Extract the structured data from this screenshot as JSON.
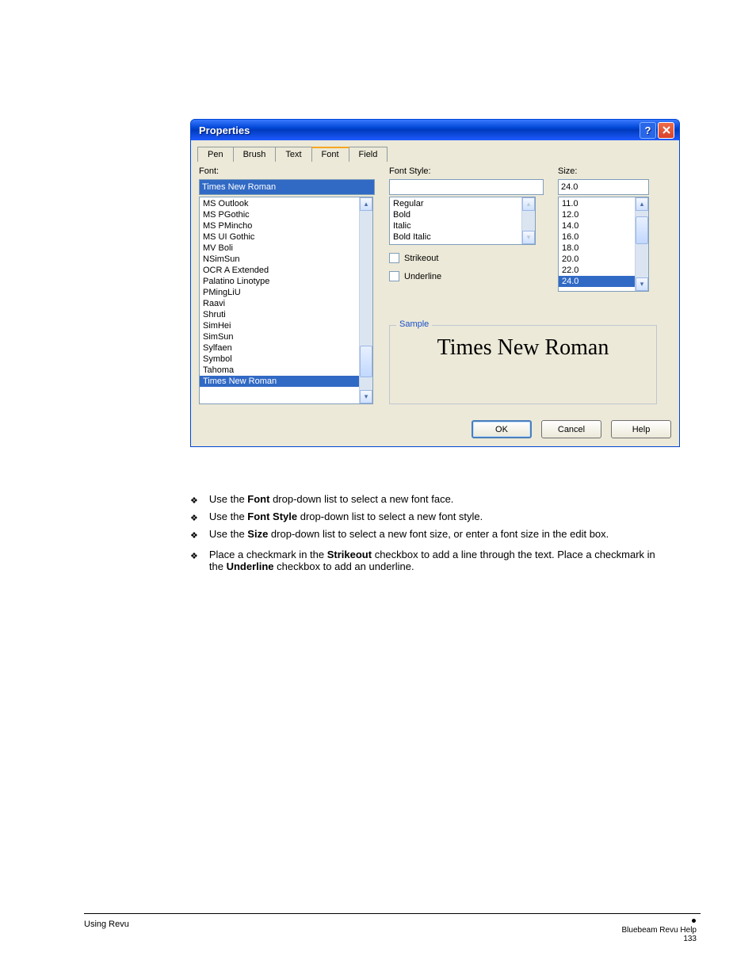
{
  "dialog": {
    "title": "Properties",
    "tabs": [
      "Pen",
      "Brush",
      "Text",
      "Font",
      "Field"
    ],
    "active_tab": "Font",
    "font": {
      "label": "Font:",
      "value": "Times New Roman",
      "list": [
        "MS Outlook",
        "MS PGothic",
        "MS PMincho",
        "MS UI Gothic",
        "MV Boli",
        "NSimSun",
        "OCR A Extended",
        "Palatino Linotype",
        "PMingLiU",
        "Raavi",
        "Shruti",
        "SimHei",
        "SimSun",
        "Sylfaen",
        "Symbol",
        "Tahoma",
        "Times New Roman"
      ],
      "selected": "Times New Roman"
    },
    "style": {
      "label": "Font Style:",
      "value": "",
      "list": [
        "Regular",
        "Bold",
        "Italic",
        "Bold Italic"
      ],
      "strikeout_label": "Strikeout",
      "underline_label": "Underline"
    },
    "size": {
      "label": "Size:",
      "value": "24.0",
      "list": [
        "11.0",
        "12.0",
        "14.0",
        "16.0",
        "18.0",
        "20.0",
        "22.0",
        "24.0"
      ],
      "selected": "24.0"
    },
    "sample": {
      "legend": "Sample",
      "text": "Times New Roman"
    },
    "buttons": {
      "ok": "OK",
      "cancel": "Cancel",
      "help": "Help"
    }
  },
  "bullets": [
    "Use the <b>Font</b> drop-down list to select a new font face.",
    "Use the <b>Font Style</b> drop-down list to select a new font style.",
    "Use the <b>Size</b> drop-down list to select a new font size, or enter a font size in the edit box.",
    "Place a checkmark in the <b>Strikeout</b> checkbox to add a line through the text. Place a checkmark in the <b>Underline</b> checkbox to add an underline."
  ],
  "footer": {
    "left": "Using Revu",
    "line1": "Bluebeam Revu Help",
    "line2": "133"
  }
}
